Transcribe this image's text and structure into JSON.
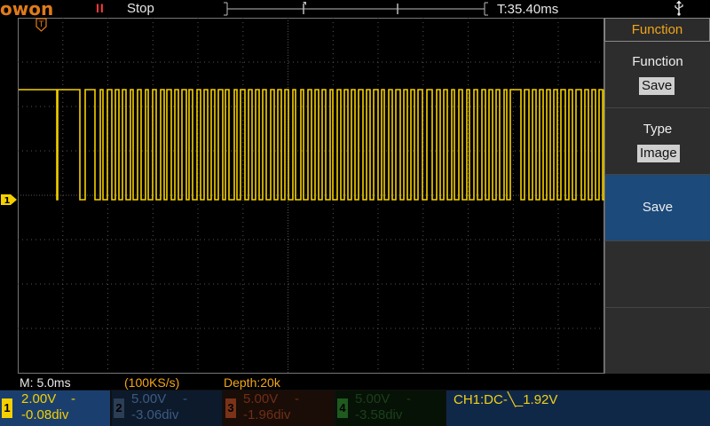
{
  "header": {
    "logo": "owon",
    "run_icon": "II",
    "status": "Stop",
    "trigger_time": "T:35.40ms"
  },
  "menu": {
    "title": "Function",
    "items": [
      {
        "label": "Function",
        "value": "Save"
      },
      {
        "label": "Type",
        "value": "Image"
      },
      {
        "label": "Save",
        "value": ""
      }
    ]
  },
  "info": {
    "timebase": "M: 5.0ms",
    "sample_rate": "(100KS/s)",
    "depth": "Depth:20k"
  },
  "channels": [
    {
      "num": "1",
      "volts": "2.00V",
      "dash": "-",
      "offset": "-0.08div",
      "color": "#f5d000",
      "bg": "#1a3f6e"
    },
    {
      "num": "2",
      "volts": "5.00V",
      "dash": "-",
      "offset": "-3.06div",
      "color": "#5b7fa6",
      "bg": "#0c1a2c"
    },
    {
      "num": "3",
      "volts": "5.00V",
      "dash": "-",
      "offset": "-1.96div",
      "color": "#b34a2a",
      "bg": "#1e0d08"
    },
    {
      "num": "4",
      "volts": "5.00V",
      "dash": "-",
      "offset": "-3.58div",
      "color": "#2e7a2e",
      "bg": "#081708"
    }
  ],
  "trigger": {
    "text": "CH1:DC-╲_1.92V",
    "marker_top": "T",
    "marker_left": "1"
  },
  "icons": {
    "usb": "usb-icon",
    "run": "pause-icon"
  },
  "colors": {
    "ch1": "#f5d000",
    "accent": "#f2a51a",
    "grid": "#555555"
  },
  "waveform": {
    "high_level": 1.6,
    "low_level": -0.04,
    "transitions_ms": [
      0.0,
      4.3,
      4.4,
      6.9,
      7.5,
      8.6,
      9.2,
      9.5,
      10.0,
      10.5,
      10.9,
      11.3,
      11.7,
      12.1,
      12.6,
      12.9,
      13.4,
      13.8,
      14.3,
      14.6,
      15.1,
      15.5,
      16.0,
      16.4,
      16.7,
      17.2,
      17.6,
      18.0,
      18.4,
      18.9,
      19.2,
      19.6,
      20.1,
      20.5,
      20.9,
      21.3,
      21.7,
      22.1,
      22.5,
      23.0,
      23.3,
      23.7,
      24.3,
      24.6,
      25.0,
      25.5,
      25.9,
      26.3,
      26.7,
      27.1,
      27.5,
      27.9,
      28.4,
      28.8,
      29.2,
      29.6,
      30.0,
      30.4,
      30.9,
      31.2,
      31.8,
      32.1,
      32.6,
      33.0,
      33.4,
      33.8,
      34.2,
      34.6,
      35.1,
      35.4,
      35.9,
      36.3,
      36.7,
      37.1,
      37.5,
      37.9,
      38.3,
      38.8,
      39.2,
      39.6,
      40.0,
      40.5,
      40.9,
      41.2,
      41.7,
      42.1,
      42.5,
      43.0,
      43.4,
      43.8,
      44.2,
      44.6,
      45.0,
      45.5,
      46.0,
      46.6,
      47.1,
      47.5,
      47.9,
      48.3,
      48.8,
      49.1,
      49.6,
      50.0,
      50.5,
      50.8,
      51.3,
      51.7,
      52.2,
      52.6,
      53.0,
      53.4,
      53.8,
      54.2,
      54.7,
      55.0,
      55.4,
      56.6,
      57.0,
      57.5,
      57.9,
      58.3,
      58.7,
      59.1,
      59.5,
      59.9,
      60.3,
      60.7,
      61.1,
      61.6,
      62.0,
      62.4,
      62.8,
      63.4,
      63.8,
      64.2,
      64.6,
      65.0,
      65.4,
      65.8,
      66.0
    ]
  }
}
